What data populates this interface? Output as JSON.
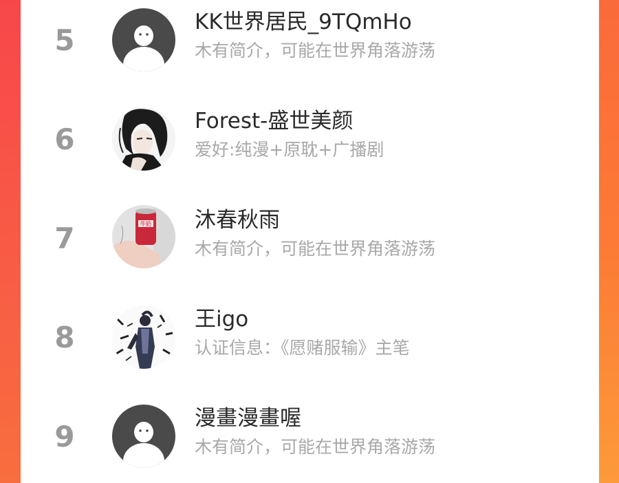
{
  "ranking": {
    "items": [
      {
        "rank": "5",
        "name": "KK世界居民_9TQmHo",
        "bio": "木有简介，可能在世界角落游荡",
        "avatar": "default-avatar-icon"
      },
      {
        "rank": "6",
        "name": "Forest-盛世美颜",
        "bio": "爱好:纯漫+原耽+广播剧",
        "avatar": "anime-man-avatar"
      },
      {
        "rank": "7",
        "name": "沐春秋雨",
        "bio": "木有简介，可能在世界角落游荡",
        "avatar": "drink-can-photo-avatar"
      },
      {
        "rank": "8",
        "name": "王igo",
        "bio": "认证信息：《愿赌服输》主笔",
        "avatar": "anime-figure-avatar"
      },
      {
        "rank": "9",
        "name": "漫畫漫畫喔",
        "bio": "木有简介，可能在世界角落游荡",
        "avatar": "default-avatar-icon"
      }
    ]
  },
  "colors": {
    "background_left": "#f7474a",
    "background_right": "#fc7a35",
    "card": "#ffffff",
    "rank": "#9a9a9a",
    "name": "#2a2a2a",
    "bio": "#a8a8a8",
    "default_avatar": "#4a4a4a"
  }
}
